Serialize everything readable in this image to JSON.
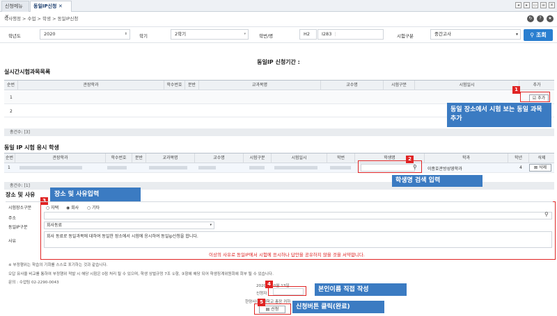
{
  "tabs": [
    {
      "label": "신청메뉴",
      "active": false
    },
    {
      "label": "동일IP신청",
      "active": true
    }
  ],
  "breadcrumb": "학사행정 > 수업 > 학생 > 동일IP신청",
  "filters": {
    "year_label": "학년도",
    "year_value": "2020",
    "term_label": "학기",
    "term_value": "2학기",
    "student_label": "학번/명",
    "student_id": "H2",
    "student_name": "I283",
    "exam_type_label": "시험구분",
    "exam_type_value": "중간고사",
    "search_button": "조회"
  },
  "period_title": "동일IP 신청기간 :",
  "section1": {
    "title": "실시간시험과목목록",
    "columns": [
      "순번",
      "관장학과",
      "학수번호",
      "분반",
      "교과목명",
      "교수명",
      "시험구분",
      "시험일시",
      "추가"
    ],
    "rows": [
      {
        "no": "1",
        "add_label": "추가"
      },
      {
        "no": "2"
      }
    ],
    "total": "총건수: [3]"
  },
  "section2": {
    "title": "동일 IP 시험 응시 학생",
    "columns": [
      "순번",
      "관장학과",
      "학수번호",
      "분반",
      "교과목명",
      "교수명",
      "시험구분",
      "시험일시",
      "학번",
      "학생명",
      "학과",
      "학년",
      "삭제"
    ],
    "row": {
      "no": "1",
      "dept": "이종호관방성영학과",
      "grade": "4",
      "delete_label": "삭제"
    },
    "total": "총건수: [1]"
  },
  "section3": {
    "title": "장소 및 사유",
    "place_type_label": "시험장소구분",
    "place_options": [
      "자택",
      "회사",
      "기타"
    ],
    "selected_place": "회사",
    "address_label": "주소",
    "relation_label": "동일IP구분",
    "relation_value": "회사동료",
    "reason_label": "사유",
    "reason_value": "회사 동료로 동일과목에 대하여 동일한 장소에서 시험에 응시하여 동일ip신청을 합니다.",
    "pledge": "이상의 사유로 동일IP에서 시험에 응시하나 답안을 공유하지 않을 것을 서약합니다."
  },
  "notes": [
    "※ 부정행위는 학습의 기회를 스스로 포기하는 것과 같습니다.",
    "오답 유사율 비교를 통하여 부정행위 적발 시 해당 시험은 0점 처리 될 수 있으며, 학생 상벌규정 7조 ①항, ③항에 해당 되어 학생징계위원회에 회부 될 수 있습니다.",
    "문의 : 수업팀 02-2290-0043"
  ],
  "signature": {
    "date": "2020년 10월 13일",
    "applicant_label": "신청자",
    "recipient": "한양사이버대학교 총장 귀하",
    "apply_button": "신청"
  },
  "callouts": [
    {
      "num": "1",
      "text": "동일 장소에서 시험 보는 동일 과목 추가"
    },
    {
      "num": "2",
      "text": "학생명 검색 입력"
    },
    {
      "num": "3",
      "text": "장소 및 사유입력"
    },
    {
      "num": "4",
      "text": "본인이름 직접 작성"
    },
    {
      "num": "5",
      "text": "신청버튼 클릭(완료)"
    }
  ],
  "colors": {
    "accent": "#2a7fd0",
    "callout": "#3b7bc2",
    "highlight": "#e02424"
  }
}
